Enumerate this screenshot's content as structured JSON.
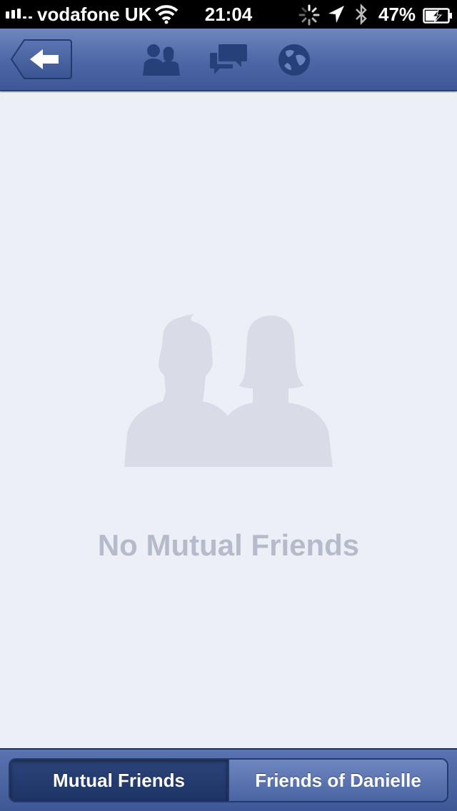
{
  "status_bar": {
    "carrier": "vodafone UK",
    "time": "21:04",
    "battery_percent": "47%",
    "signal_strength": 3,
    "icons": [
      "signal-icon",
      "wifi-icon",
      "activity-spinner-icon",
      "location-arrow-icon",
      "bluetooth-icon",
      "battery-charging-icon"
    ]
  },
  "nav_bar": {
    "back_icon": "back-arrow-icon",
    "tabs": [
      {
        "icon": "friend-requests-icon"
      },
      {
        "icon": "messages-icon"
      },
      {
        "icon": "notifications-globe-icon"
      }
    ]
  },
  "content": {
    "empty_icon": "two-people-silhouette-icon",
    "empty_title": "No Mutual Friends"
  },
  "segmented_control": {
    "segments": [
      {
        "label": "Mutual Friends",
        "selected": true
      },
      {
        "label": "Friends of Danielle",
        "selected": false
      }
    ]
  },
  "colors": {
    "nav_blue": "#4F69A8",
    "content_background": "#ECEFF6",
    "empty_text": "#B6BBCB",
    "silhouette": "#D9DCE6",
    "icon_dark_blue": "#26407A"
  }
}
